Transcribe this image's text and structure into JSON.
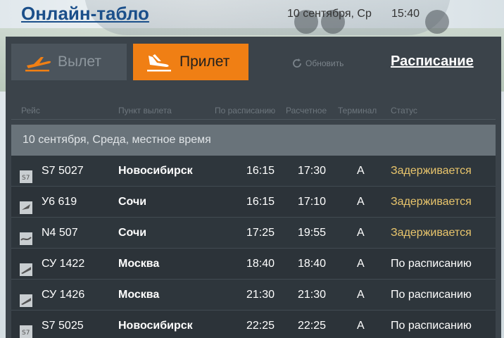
{
  "header": {
    "title": "Онлайн-табло",
    "date": "10 сентября, Ср",
    "time": "15:40"
  },
  "tabs": {
    "departure_label": "Вылет",
    "arrival_label": "Прилет"
  },
  "refresh_label": "Обновить",
  "schedule_link": "Расписание",
  "columns": {
    "flight": "Рейс",
    "origin": "Пункт вылета",
    "scheduled": "По расписанию",
    "estimated": "Расчетное",
    "terminal": "Терминал",
    "status": "Статус"
  },
  "date_band": "10 сентября, Среда, местное время",
  "flights": [
    {
      "flight": "S7 5027",
      "city": "Новосибирск",
      "scheduled": "16:15",
      "estimated": "17:30",
      "terminal": "A",
      "status": "Задерживается",
      "logo": "s7-logo-icon"
    },
    {
      "flight": "У6 619",
      "city": "Сочи",
      "scheduled": "16:15",
      "estimated": "17:10",
      "terminal": "A",
      "status": "Задерживается",
      "logo": "ural-logo-icon"
    },
    {
      "flight": "N4 507",
      "city": "Сочи",
      "scheduled": "17:25",
      "estimated": "19:55",
      "terminal": "A",
      "status": "Задерживается",
      "logo": "nordwind-logo-icon"
    },
    {
      "flight": "СУ 1422",
      "city": "Москва",
      "scheduled": "18:40",
      "estimated": "18:40",
      "terminal": "A",
      "status": "По расписанию",
      "logo": "aeroflot-logo-icon"
    },
    {
      "flight": "СУ 1426",
      "city": "Москва",
      "scheduled": "21:30",
      "estimated": "21:30",
      "terminal": "A",
      "status": "По расписанию",
      "logo": "aeroflot-logo-icon"
    },
    {
      "flight": "S7 5025",
      "city": "Новосибирск",
      "scheduled": "22:25",
      "estimated": "22:25",
      "terminal": "A",
      "status": "По расписанию",
      "logo": "s7-logo-icon"
    }
  ],
  "colors": {
    "accent": "#f07f14",
    "board": "#3b434a",
    "delayed": "#e9c56c",
    "title": "#1b4f8a"
  }
}
